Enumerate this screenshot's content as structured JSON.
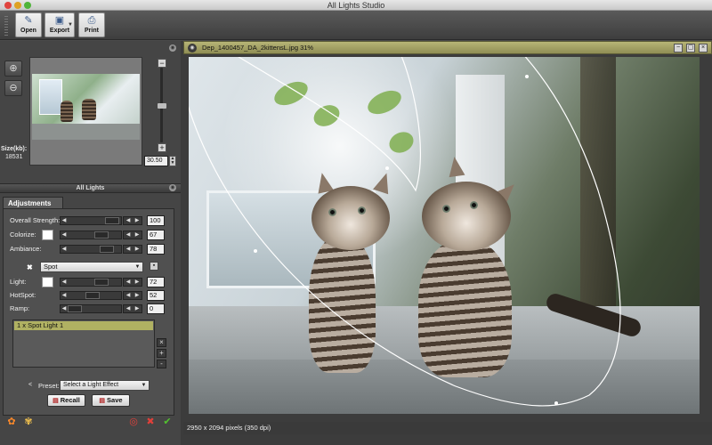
{
  "window": {
    "title": "All Lights Studio"
  },
  "toolbar": {
    "open_label": "Open",
    "export_label": "Export",
    "print_label": "Print"
  },
  "navigator": {
    "size_label": "Size(kb):",
    "size_value": "18531",
    "zoom_value": "30.50"
  },
  "all_lights": {
    "header": "All Lights"
  },
  "adjustments": {
    "tab_label": "Adjustments",
    "overall_strength": {
      "label": "Overall Strength:",
      "value": "100"
    },
    "colorize": {
      "label": "Colorize:",
      "value": "67"
    },
    "ambiance": {
      "label": "Ambiance:",
      "value": "78"
    },
    "light_type": {
      "selected": "Spot"
    },
    "light": {
      "label": "Light:",
      "value": "72"
    },
    "hotspot": {
      "label": "HotSpot:",
      "value": "52"
    },
    "ramp": {
      "label": "Ramp:",
      "value": "0"
    },
    "lights_list": [
      "1   x Spot Light 1"
    ],
    "preset": {
      "label": "Preset:",
      "selected": "Select a Light Effect"
    },
    "recall_label": "Recall",
    "save_label": "Save"
  },
  "document": {
    "title": "Dep_1400457_DA_2kittensL.jpg 31%",
    "status": "2950 x 2094 pixels (350 dpi)"
  },
  "colors": {
    "doc_header": "#a4a265",
    "selected_light": "#b0b162",
    "panel_bg": "#454545"
  },
  "icons": {
    "zoom_in": "zoom-in-icon",
    "zoom_out": "zoom-out-icon",
    "bottom_left": [
      "flower-icon",
      "flower-multi-icon"
    ],
    "bottom_right": [
      "reset-icon",
      "cancel-icon",
      "apply-icon"
    ]
  }
}
